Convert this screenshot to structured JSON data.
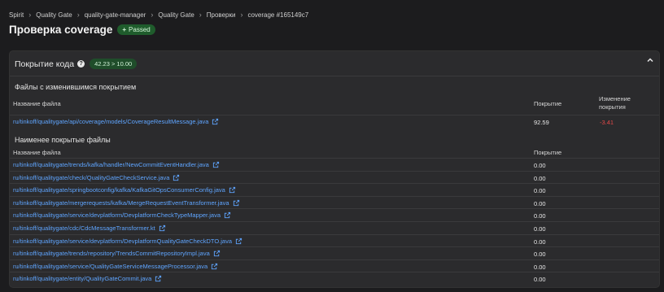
{
  "breadcrumb": [
    "Spirit",
    "Quality Gate",
    "quality-gate-manager",
    "Quality Gate",
    "Проверки",
    "coverage #165149c7"
  ],
  "page": {
    "title": "Проверка coverage",
    "status_badge": "Passed",
    "status_color": "#1f5c2c"
  },
  "card": {
    "title": "Покрытие кода",
    "metric_badge": "42.23 > 10.00",
    "changed_section": {
      "title": "Файлы с изменившимся покрытием",
      "columns": [
        "Название файла",
        "Покрытие",
        "Изменение покрытия"
      ],
      "rows": [
        {
          "file": "ru/tinkoff/qualitygate/api/coverage/models/CoverageResultMessage.java",
          "coverage": "92.59",
          "change": "-3.41"
        }
      ]
    },
    "least_section": {
      "title": "Наименее покрытые файлы",
      "columns": [
        "Название файла",
        "Покрытие"
      ],
      "rows": [
        {
          "file": "ru/tinkoff/qualitygate/trends/kafka/handler/NewCommitEventHandler.java",
          "coverage": "0.00"
        },
        {
          "file": "ru/tinkoff/qualitygate/check/QualityGateCheckService.java",
          "coverage": "0.00"
        },
        {
          "file": "ru/tinkoff/qualitygate/springbootconfig/kafka/KafkaGitOpsConsumerConfig.java",
          "coverage": "0.00"
        },
        {
          "file": "ru/tinkoff/qualitygate/mergerequests/kafka/MergeRequestEventTransformer.java",
          "coverage": "0.00"
        },
        {
          "file": "ru/tinkoff/qualitygate/service/devplatform/DevplatformCheckTypeMapper.java",
          "coverage": "0.00"
        },
        {
          "file": "ru/tinkoff/qualitygate/cdc/CdcMessageTransformer.kt",
          "coverage": "0.00"
        },
        {
          "file": "ru/tinkoff/qualitygate/service/devplatform/DevplatformQualityGateCheckDTO.java",
          "coverage": "0.00"
        },
        {
          "file": "ru/tinkoff/qualitygate/trends/repository/TrendsCommitRepositoryImpl.java",
          "coverage": "0.00"
        },
        {
          "file": "ru/tinkoff/qualitygate/service/QualityGateServiceMessageProcessor.java",
          "coverage": "0.00"
        },
        {
          "file": "ru/tinkoff/qualitygate/entity/QualityGateCommit.java",
          "coverage": "0.00"
        }
      ]
    }
  },
  "icons": {
    "help": "question-circle-icon",
    "collapse": "chevron-up-icon",
    "external": "external-link-icon",
    "separator": "chevron-right-icon"
  },
  "colors": {
    "link": "#5fa5ff",
    "negative": "#e04848",
    "passed": "#1f5c2c"
  }
}
